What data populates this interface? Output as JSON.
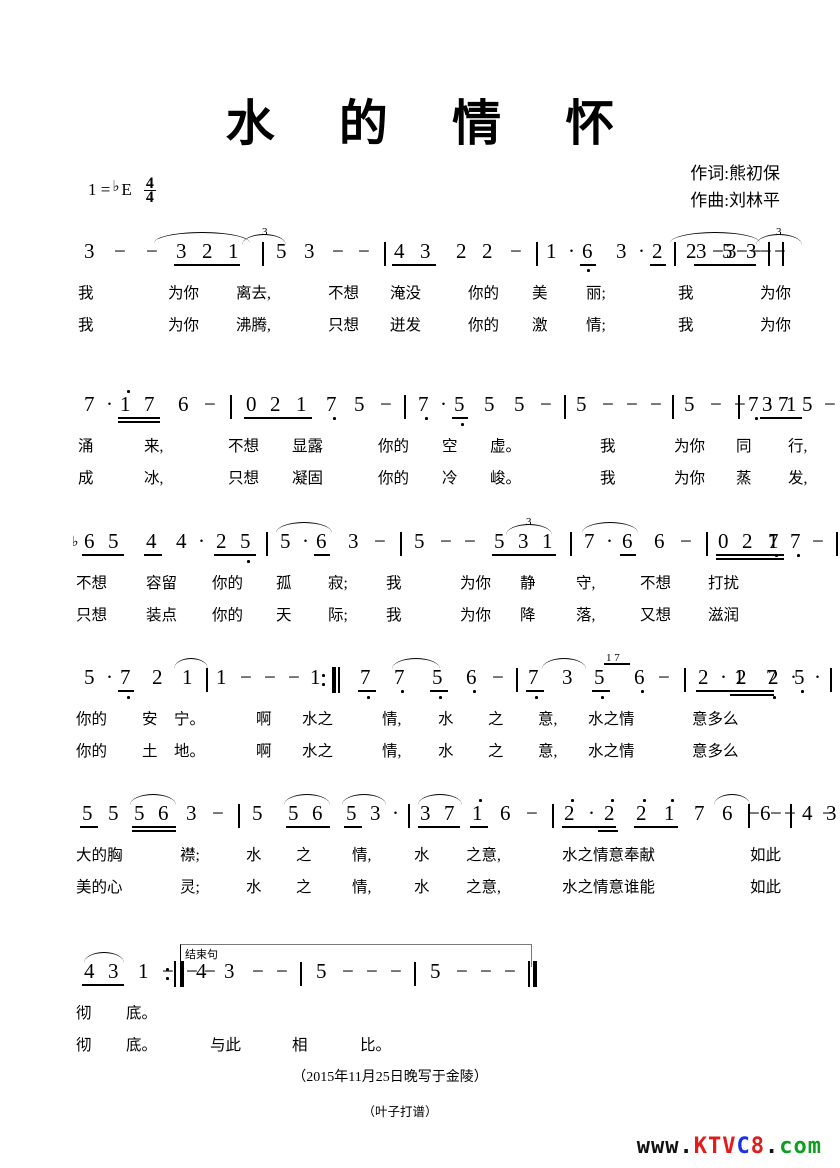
{
  "document": {
    "type": "numbered-musical-notation-score",
    "title": "水 的 情 怀"
  },
  "credits": {
    "lyricist": "作词:熊初保",
    "composer": "作曲:刘林平"
  },
  "key_signature": {
    "do_label": "1 =",
    "flat": "♭",
    "key": "E",
    "meter_numerator": "4",
    "meter_denominator": "4"
  },
  "systems": [
    {
      "id": "system-1",
      "measures": "3 - - 3̲2̲1̲ | 5 3 - - | 4̲3̲ 2 2 - | 1 · 6̲̣ 3 · 2̲ | 2 - - - | 3 - - 3̲5̲3̲ |",
      "notes": [
        "3",
        "-",
        "-",
        "3",
        "2",
        "1",
        "5",
        "3",
        "-",
        "-",
        "4",
        "3",
        "2",
        "2",
        "-",
        "1",
        "·",
        "6",
        "3",
        "·",
        "2",
        "2",
        "-",
        "-",
        "-",
        "3",
        "-",
        "-",
        "3",
        "5",
        "3"
      ],
      "lyrics_line1": "我 为你 离去, 不想 淹没 你的 美 丽; 我 为你",
      "lyrics_line2": "我 为你 沸腾, 只想 迸发 你的 激 情; 我 为你",
      "triplets": [
        "3 2 1",
        "3 5 3"
      ]
    },
    {
      "id": "system-2",
      "measures": "7 · 1̲̇7̲ 6 - | 0̲2̲1̲ 7̣ 5 - | 7̣ · 5̲̣ 5 5 - | 5 - - - | 5 - - 3̲1̲ | 7̣ · 7̲ 5 - |",
      "notes": [
        "7",
        "·",
        "1",
        "7",
        "6",
        "-",
        "0",
        "2",
        "1",
        "7",
        "5",
        "-",
        "7",
        "·",
        "5",
        "5",
        "5",
        "-",
        "5",
        "-",
        "-",
        "-",
        "5",
        "-",
        "-",
        "3",
        "1",
        "7",
        "·",
        "7",
        "5",
        "-"
      ],
      "lyrics_line1": "涌 来, 不想 显露 你的 空 虚。 我 为你 同 行,",
      "lyrics_line2": "成 冰, 只想 凝固 你的 冷 峻。 我 为你 蒸 发,"
    },
    {
      "id": "system-3",
      "measures": "♭6̲5̲ 4̲ 4 · 2̲5̲̣ | 5 · 6̲ 3 - | 5 - - 5̲3̲1̲ | 7 · 6̲ 6 - | 0̲2̲1̲ 7̣ 7̣ - |",
      "notes": [
        "♭6",
        "5",
        "4",
        "4",
        "·",
        "2",
        "5",
        "5",
        "·",
        "6",
        "3",
        "-",
        "5",
        "-",
        "-",
        "5",
        "3",
        "1",
        "7",
        "·",
        "6",
        "6",
        "-",
        "0",
        "2",
        "1",
        "7",
        "7",
        "-"
      ],
      "lyrics_line1": "不想 容留 你的 孤 寂; 我 为你 静 守, 不想 打扰",
      "lyrics_line2": "只想 装点 你的 天 际; 我 为你 降 落, 又想 滋润",
      "triplets": [
        "5 3 1"
      ]
    },
    {
      "id": "system-4",
      "measures": "5 · 7̲̣ 2 1 | 1 - - 1 ‖: 7̲̣ 7̣ 5̲̣ 6̣ - | 7̲̣ 3 5̲̣ 6̣ - | 2̲ · 2̲ 2̲ · 1̲ 7̲̣ 5̣ · |",
      "notes": [
        "5",
        "·",
        "7",
        "2",
        "1",
        "1",
        "-",
        "-",
        "1",
        "7",
        "7",
        "5",
        "6",
        "-",
        "7",
        "3",
        "5",
        "6",
        "-",
        "2",
        "·",
        "2",
        "2",
        "·",
        "1",
        "7",
        "5",
        "·"
      ],
      "grace_notes": "1 7",
      "repeat_start": "‖:",
      "lyrics_line1": "你的 安 宁。 啊 水之 情, 水 之 意, 水之情 意多么",
      "lyrics_line2": "你的 土 地。 啊 水之 情, 水 之 意, 水之情 意多么"
    },
    {
      "id": "system-5",
      "measures": "5̲5 5̲̲6̲̲ 3 - | 5 5̲6̲ 5̲3 · | 3̲7̲ 1̲̇ 6 - | 2̲̇ · 2̲̇ 2̲̇1̲̇ 7 6̂ | 6 - - - | 4 3 - - |",
      "notes": [
        "5",
        "5",
        "5",
        "6",
        "3",
        "-",
        "5",
        "5",
        "6",
        "5",
        "3",
        "·",
        "3",
        "7",
        "1",
        "6",
        "-",
        "2",
        "·",
        "2",
        "2",
        "1",
        "7",
        "6",
        "6",
        "-",
        "-",
        "-",
        "4",
        "3",
        "-",
        "-"
      ],
      "lyrics_line1": "大的胸 襟; 水 之 情, 水 之意, 水之情意奉献 如此",
      "lyrics_line2": "美的心 灵; 水 之 情, 水 之意, 水之情意谁能 如此"
    },
    {
      "id": "system-6",
      "measures": "4̲3̲ 1 - - :‖ 4 3 - - | 5 - - - | 5 - - - ‖",
      "notes": [
        "4",
        "3",
        "1",
        "-",
        "-",
        "4",
        "3",
        "-",
        "-",
        "5",
        "-",
        "-",
        "-",
        "5",
        "-",
        "-",
        "-"
      ],
      "repeat_end": ":‖",
      "ending_label": "结束句",
      "lyrics_line1": "彻 底。",
      "lyrics_line2": "彻 底。 与此 相 比。"
    }
  ],
  "footer": {
    "date_note": "（2015年11月25日晚写于金陵）",
    "engraver_note": "（叶子打谱）",
    "watermark": {
      "www": "www.",
      "ktv": "KTV",
      "c": "C",
      "eight": "8",
      "dot": ".",
      "com": "com"
    }
  }
}
